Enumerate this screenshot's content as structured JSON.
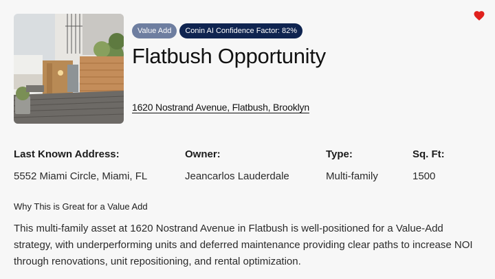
{
  "property": {
    "title": "Flatbush Opportunity",
    "address": "1620 Nostrand Avenue, Flatbush, Brooklyn",
    "favorite_icon": "heart-icon",
    "badges": {
      "value_add": "Value Add",
      "confidence": "Conin AI Confidence Factor: 82%"
    }
  },
  "details": {
    "last_known_address": {
      "label": "Last Known Address:",
      "value": "5552 Miami Circle, Miami, FL"
    },
    "owner": {
      "label": "Owner:",
      "value": "Jeancarlos Lauderdale"
    },
    "type": {
      "label": "Type:",
      "value": "Multi-family"
    },
    "sqft": {
      "label": "Sq. Ft:",
      "value": "1500"
    }
  },
  "why": {
    "heading": "Why This is Great for a Value Add",
    "body": "This multi-family asset at 1620 Nostrand Avenue in Flatbush is well-positioned for a Value-Add strategy, with underperforming units and deferred maintenance providing clear paths to increase NOI through renovations, unit repositioning, and rental optimization."
  },
  "colors": {
    "favorite": "#e0211d",
    "badge_value_add": "#6e7ea0",
    "badge_confidence": "#0f2450"
  }
}
